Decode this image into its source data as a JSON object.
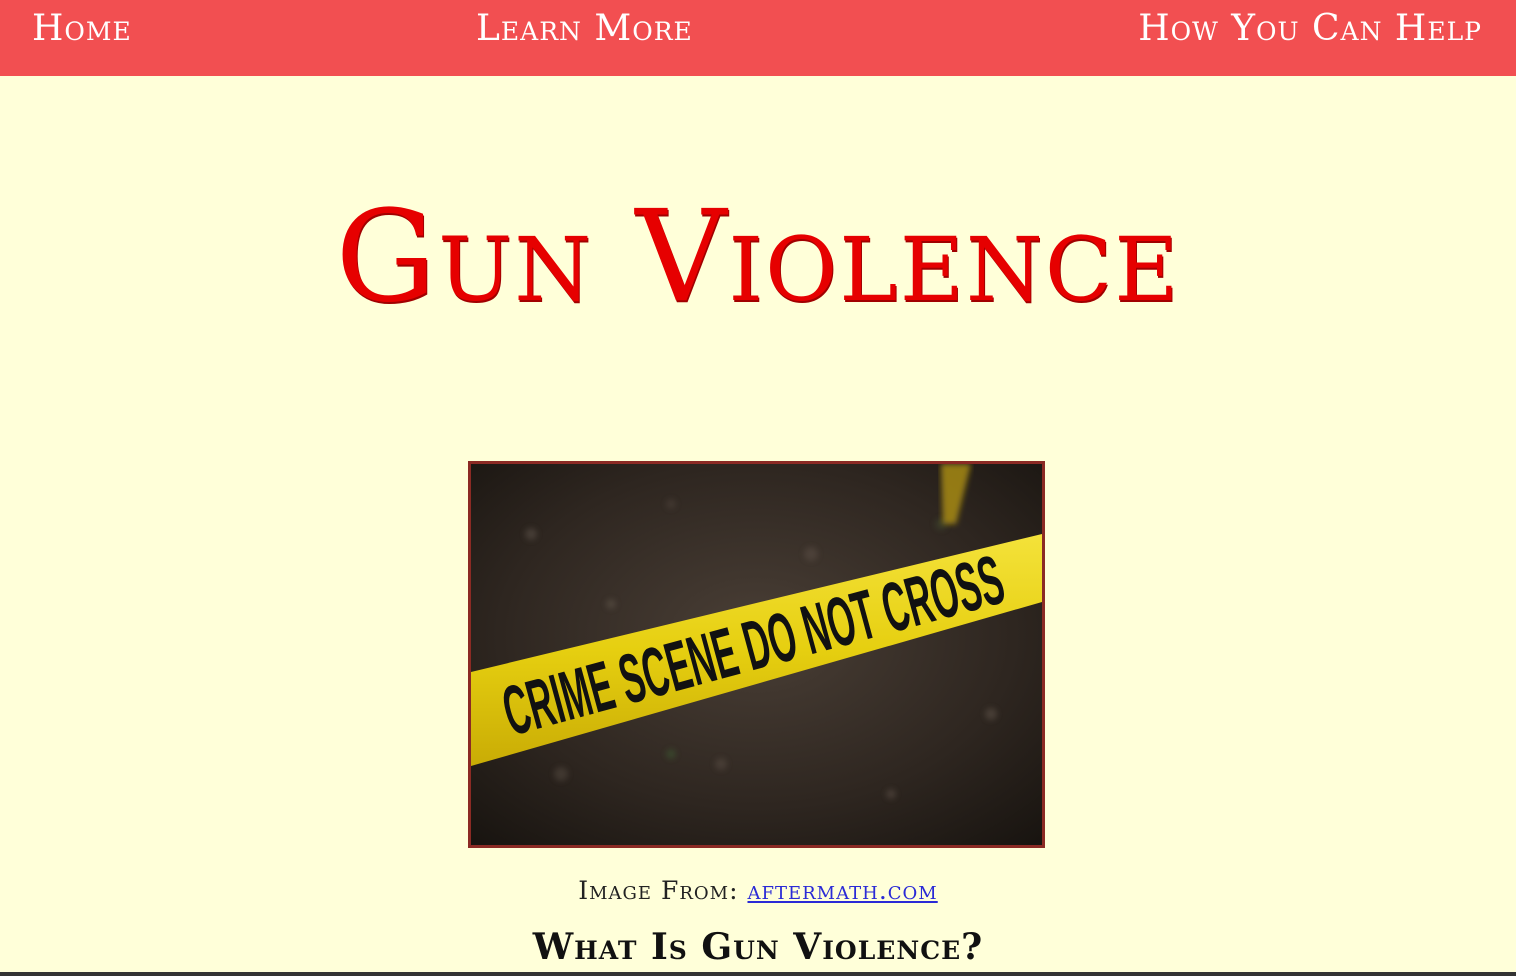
{
  "nav": {
    "home": "Home",
    "learn_more": "Learn More",
    "how_you_can_help": "How You Can Help"
  },
  "page_title": "Gun Violence",
  "hero": {
    "tape_text": "CRIME SCENE DO NOT CROSS"
  },
  "credit": {
    "prefix": "Image From: ",
    "link_text": "aftermath.com"
  },
  "section_heading": "What Is Gun Violence?",
  "colors": {
    "navbar": "#f24f51",
    "background": "#ffffd9",
    "title": "#e60000",
    "image_border": "#8b2a24",
    "link": "#2a2ad6"
  }
}
